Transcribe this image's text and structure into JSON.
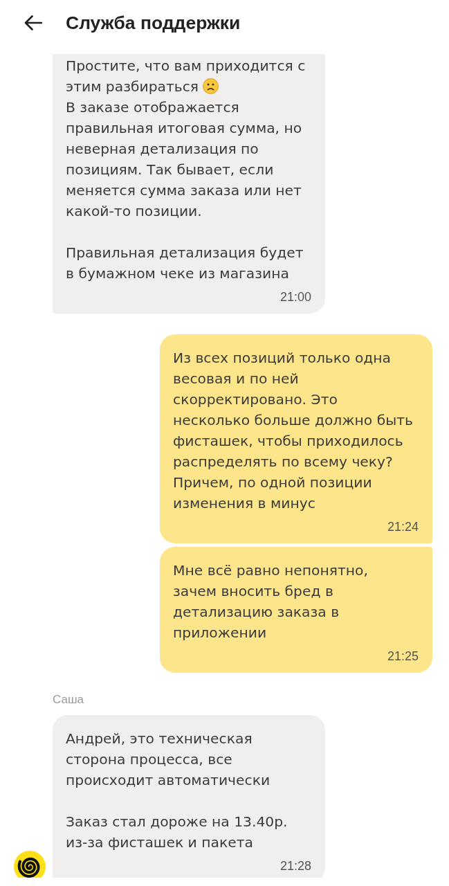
{
  "header": {
    "title": "Служба поддержки"
  },
  "messages": [
    {
      "kind": "support",
      "avatar": false,
      "paragraphs": [
        {
          "lines": [
            {
              "text": "Простите, что вам приходится с\nэтим разбираться",
              "emoji": true
            },
            {
              "text": "В заказе отображается\nправильная итоговая сумма, но\nневерная детализация по\nпозициям. Так бывает, если\nменяется сумма заказа или нет\nкакой-то позиции.",
              "emoji": false
            }
          ]
        },
        {
          "lines": [
            {
              "text": "Правильная детализация будет\nв бумажном чеке из магазина",
              "emoji": false
            }
          ]
        }
      ],
      "time": "21:00"
    },
    {
      "kind": "user",
      "paragraphs": [
        {
          "lines": [
            {
              "text": "Из всех позиций только одна\nвесовая и по ней\nскорректировано. Это\nнесколько больше должно быть\nфисташек, чтобы приходилось\nраспределять по всему чеку?\nПричем, по одной позиции\nизменения в минус",
              "emoji": false
            }
          ]
        }
      ],
      "time": "21:24"
    },
    {
      "kind": "user",
      "paragraphs": [
        {
          "lines": [
            {
              "text": "Мне всё равно непонятно,\nзачем вносить бред в\nдетализацию заказа в\nприложении",
              "emoji": false
            }
          ]
        }
      ],
      "time": "21:25"
    },
    {
      "kind": "support",
      "author": "Саша",
      "avatar": true,
      "paragraphs": [
        {
          "lines": [
            {
              "text": "Андрей, это техническая\nсторона процесса, все\nпроисходит автоматически",
              "emoji": false
            }
          ]
        },
        {
          "lines": [
            {
              "text": "Заказ стал дороже на 13.40р.\nиз-за фисташек и пакета",
              "emoji": false
            }
          ]
        }
      ],
      "time": "21:28"
    }
  ]
}
